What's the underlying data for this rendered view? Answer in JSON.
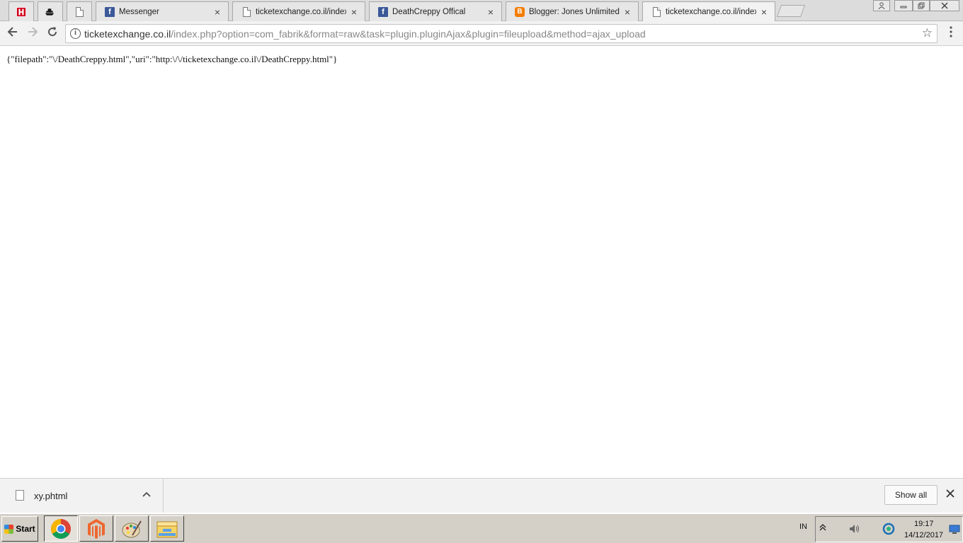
{
  "browser": {
    "tabs": [
      {
        "label": "",
        "favicon": "h-logo-icon",
        "closable": false
      },
      {
        "label": "",
        "favicon": "ship-icon",
        "closable": false
      },
      {
        "label": "",
        "favicon": "document-icon",
        "closable": false
      },
      {
        "label": "Messenger",
        "favicon": "facebook-icon",
        "closable": true
      },
      {
        "label": "ticketexchange.co.il/index.p",
        "favicon": "document-icon",
        "closable": true
      },
      {
        "label": "DeathCreppy Offical",
        "favicon": "facebook-icon",
        "closable": true
      },
      {
        "label": "Blogger: Jones Unlimited Ed",
        "favicon": "blogger-icon",
        "closable": true
      },
      {
        "label": "ticketexchange.co.il/index.p",
        "favicon": "document-icon",
        "closable": true,
        "active": true
      }
    ],
    "close_glyph": "×",
    "address": {
      "host": "ticketexchange.co.il",
      "path": "/index.php?option=com_fabrik&format=raw&task=plugin.pluginAjax&plugin=fileupload&method=ajax_upload"
    }
  },
  "page": {
    "body_text": "{\"filepath\":\"\\/DeathCreppy.html\",\"uri\":\"http:\\/\\/ticketexchange.co.il\\/DeathCreppy.html\"}"
  },
  "download_bar": {
    "file_name": "xy.phtml",
    "show_all_label": "Show all"
  },
  "taskbar": {
    "start_label": "Start",
    "apps": [
      "chrome-icon",
      "magento-icon",
      "paint-icon",
      "file-explorer-icon"
    ],
    "language": "IN",
    "time": "19:17",
    "date": "14/12/2017"
  },
  "colors": {
    "facebook": "#3b5998",
    "blogger": "#f57d00",
    "h_logo": "#d0021b"
  }
}
